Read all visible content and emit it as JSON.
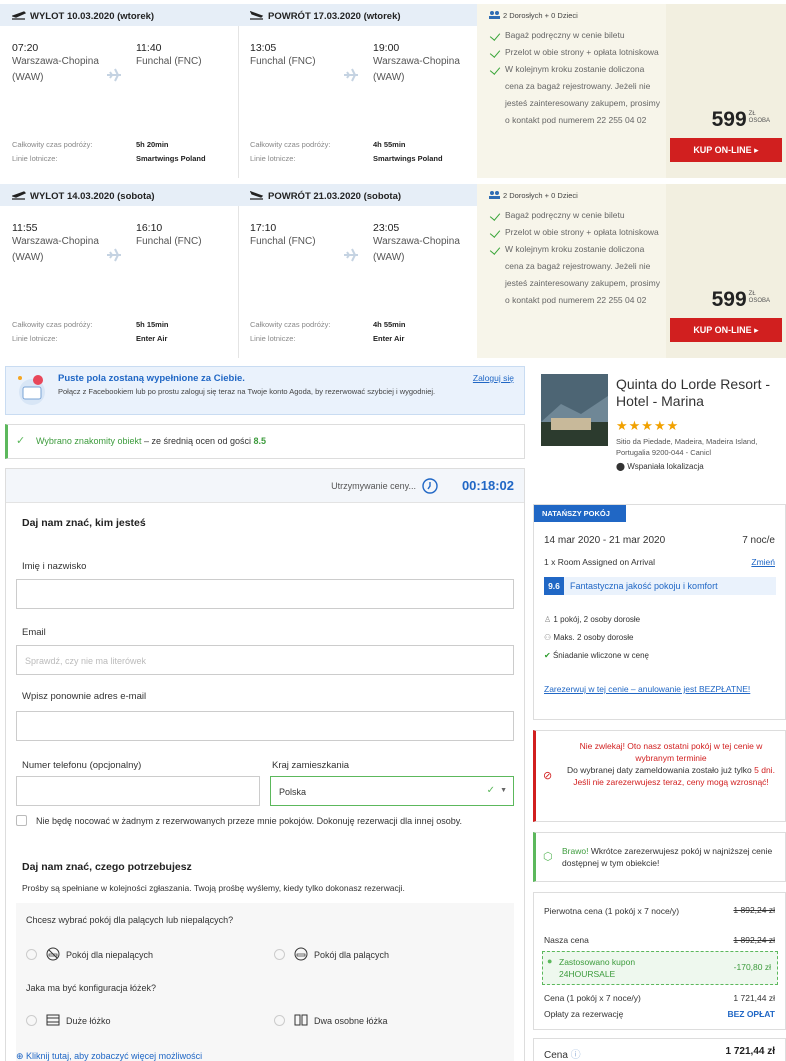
{
  "flights": [
    {
      "outbound_header": "WYLOT 10.03.2020 (wtorek)",
      "return_header": "POWRÓT 17.03.2020 (wtorek)",
      "out": {
        "dep_time": "07:20",
        "dep_place": "Warszawa-Chopina (WAW)",
        "arr_time": "11:40",
        "arr_place": "Funchal (FNC)",
        "duration_label": "Całkowity czas podróży:",
        "duration": "5h 20min",
        "airline_label": "Linie lotnicze:",
        "airline": "Smartwings Poland"
      },
      "ret": {
        "dep_time": "13:05",
        "dep_place": "Funchal (FNC)",
        "arr_time": "19:00",
        "arr_place": "Warszawa-Chopina (WAW)",
        "duration_label": "Całkowity czas podróży:",
        "duration": "4h 55min",
        "airline_label": "Linie lotnicze:",
        "airline": "Smartwings Poland"
      },
      "pax": "2 Dorosłych + 0 Dzieci",
      "perks": [
        "Bagaż podręczny w cenie biletu",
        "Przelot w obie strony + opłata lotniskowa",
        "W kolejnym kroku zostanie doliczona cena za bagaż rejestrowany. Jeżeli nie jesteś zainteresowany zakupem, prosimy o kontakt pod numerem 22 255 04 02"
      ],
      "price": "599",
      "currency": "ZŁ",
      "per": "OSOBA",
      "buy_label": "KUP ON-LINE ▸"
    },
    {
      "outbound_header": "WYLOT 14.03.2020 (sobota)",
      "return_header": "POWRÓT 21.03.2020 (sobota)",
      "out": {
        "dep_time": "11:55",
        "dep_place": "Warszawa-Chopina (WAW)",
        "arr_time": "16:10",
        "arr_place": "Funchal (FNC)",
        "duration_label": "Całkowity czas podróży:",
        "duration": "5h 15min",
        "airline_label": "Linie lotnicze:",
        "airline": "Enter Air"
      },
      "ret": {
        "dep_time": "17:10",
        "dep_place": "Funchal (FNC)",
        "arr_time": "23:05",
        "arr_place": "Warszawa-Chopina (WAW)",
        "duration_label": "Całkowity czas podróży:",
        "duration": "4h 55min",
        "airline_label": "Linie lotnicze:",
        "airline": "Enter Air"
      },
      "pax": "2 Dorosłych + 0 Dzieci",
      "perks": [
        "Bagaż podręczny w cenie biletu",
        "Przelot w obie strony + opłata lotniskowa",
        "W kolejnym kroku zostanie doliczona cena za bagaż rejestrowany. Jeżeli nie jesteś zainteresowany zakupem, prosimy o kontakt pod numerem 22 255 04 02"
      ],
      "price": "599",
      "currency": "ZŁ",
      "per": "OSOBA",
      "buy_label": "KUP ON-LINE ▸"
    }
  ],
  "booking": {
    "fb_title": "Puste pola zostaną wypełnione za Ciebie.",
    "fb_sub": "Połącz z Facebookiem lub po prostu zaloguj się teraz na Twoje konto Agoda, by rezerwować szybciej i wygodniej.",
    "login": "Zaloguj się",
    "selected_strong": "Wybrano znakomity obiekt",
    "selected_rest": " – ze średnią ocen od gości ",
    "selected_score": "8.5",
    "hold_label": "Utrzymywanie ceny...",
    "hold_timer": "00:18:02",
    "who_title": "Daj nam znać, kim jesteś",
    "name_label": "Imię i nazwisko",
    "email_label": "Email",
    "email_placeholder": "Sprawdź, czy nie ma literówek",
    "email2_label": "Wpisz ponownie adres e-mail",
    "phone_label": "Numer telefonu (opcjonalny)",
    "country_label": "Kraj zamieszkania",
    "country_value": "Polska",
    "not_staying": "Nie będę nocować w żadnym z rezerwowanych przeze mnie pokojów. Dokonuję rezerwacji dla innej osoby.",
    "needs_title": "Daj nam znać, czego potrzebujesz",
    "needs_sub": "Prośby są spełniane w kolejności zgłaszania. Twoją prośbę wyślemy, kiedy tylko dokonasz rezerwacji.",
    "smoking_q": "Chcesz wybrać pokój dla palących lub niepalących?",
    "non_smoking": "Pokój dla niepalących",
    "smoking": "Pokój dla palących",
    "bed_q": "Jaka ma być konfiguracja łóżek?",
    "large_bed": "Duże łóżko",
    "twin_beds": "Dwa osobne łóżka",
    "more": "Kliknij tutaj, aby zobaczyć więcej możliwości"
  },
  "hotel": {
    "name": "Quinta do Lorde Resort - Hotel - Marina",
    "stars": "★★★★★",
    "address": "Sitio da Piedade, Madeira, Madeira Island, Portugalia 9200-044 - Canicl",
    "location": "Wspaniała lokalizacja",
    "ribbon": "NATAŃSZY POKÓJ",
    "dates": "14 mar 2020 - 21 mar 2020",
    "nights": "7 noc/e",
    "room": "1 x Room Assigned on Arrival",
    "change": "Zmień",
    "score": "9.6",
    "score_text": "Fantastyczna jakość pokoju i komfort",
    "f1": "1 pokój, 2 osoby dorosłe",
    "f2": "Maks. 2 osoby dorosłe",
    "f3": "Śniadanie wliczone w cenę",
    "cancel": "Zarezerwuj w tej cenie – anulowanie jest BEZPŁATNE!",
    "urgent_title": "Nie zwlekaj! Oto nasz ostatni pokój w tej cenie w wybranym terminie",
    "urgent_body": "Do wybranej daty zameldowania zostało już tylko ",
    "urgent_days": "5 dni.",
    "urgent_tail": " Jeśli nie zarezerwujesz teraz, ceny mogą wzrosnąć!",
    "bravo": "Brawo!",
    "bravo_text": " Wkrótce zarezerwujesz pokój w najniższej cenie dostępnej w tym obiekcie!",
    "orig_label": "Pierwotna cena (1 pokój x 7 noce/y)",
    "orig_val": "1 892,24 zł",
    "our_label": "Nasza cena",
    "our_val": "1 892,24 zł",
    "coupon_label": "Zastosowano kupon 24HOURSALE",
    "coupon_val": "-170,80 zł",
    "price_label": "Cena (1 pokój x 7 noce/y)",
    "price_val": "1 721,44 zł",
    "fee_label": "Opłaty za rezerwację",
    "fee_val": "BEZ OPŁAT",
    "total_label": "Cena",
    "total_val": "1 721,44 zł"
  }
}
